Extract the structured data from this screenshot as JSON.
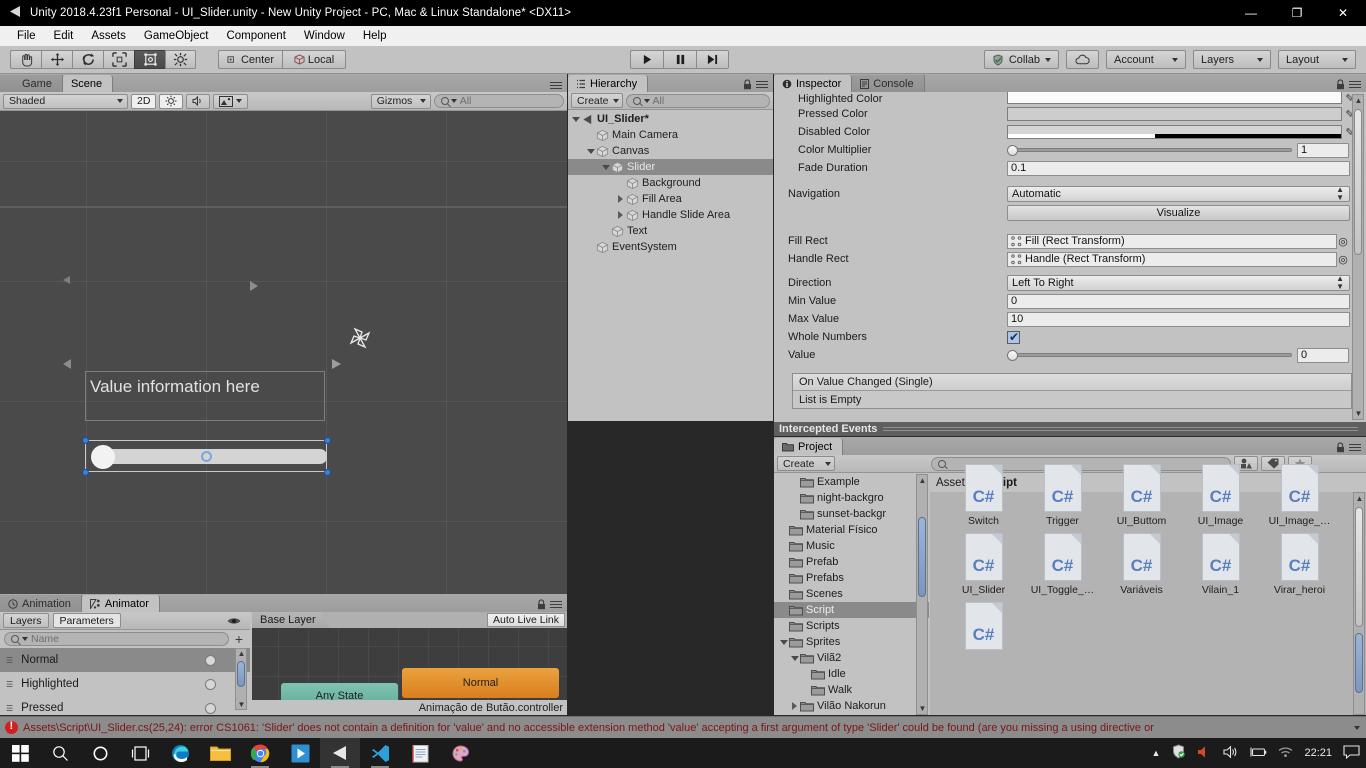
{
  "window": {
    "title": "Unity 2018.4.23f1 Personal - UI_Slider.unity - New Unity Project - PC, Mac & Linux Standalone* <DX11>",
    "minimize": "—",
    "maximize": "❐",
    "close": "✕"
  },
  "menubar": {
    "items": [
      "File",
      "Edit",
      "Assets",
      "GameObject",
      "Component",
      "Window",
      "Help"
    ]
  },
  "toolbar": {
    "transform_tools": [
      "hand-tool",
      "move-tool",
      "rotate-tool",
      "scale-tool",
      "rect-tool",
      "transform-tool"
    ],
    "selected_tool_index": 4,
    "pivot_label": "Center",
    "space_label": "Local",
    "play": "▶",
    "pause": "❙❙",
    "step": "▶❘",
    "collab_label": "Collab",
    "cloud_label": "☁",
    "account_label": "Account",
    "layers_label": "Layers",
    "layout_label": "Layout"
  },
  "scene_view": {
    "tabs": [
      {
        "label": "Game",
        "active": false
      },
      {
        "label": "Scene",
        "active": true
      }
    ],
    "shading_mode": "Shaded",
    "mode_2d": "2D",
    "gizmos_label": "Gizmos",
    "search_placeholder": "All",
    "canvas_text": "Value information here",
    "slider_value_position_pct": 0
  },
  "hierarchy": {
    "title": "Hierarchy",
    "create_label": "Create",
    "search_placeholder": "All",
    "items": [
      {
        "label": "UI_Slider*",
        "depth": 0,
        "foldout": "open",
        "icon": "unity-scene-icon",
        "root": true,
        "selected": false
      },
      {
        "label": "Main Camera",
        "depth": 1,
        "foldout": "none",
        "icon": "gameobject-icon",
        "selected": false
      },
      {
        "label": "Canvas",
        "depth": 1,
        "foldout": "open",
        "icon": "gameobject-icon",
        "selected": false
      },
      {
        "label": "Slider",
        "depth": 2,
        "foldout": "open",
        "icon": "gameobject-icon",
        "selected": true
      },
      {
        "label": "Background",
        "depth": 3,
        "foldout": "none",
        "icon": "gameobject-icon",
        "selected": false
      },
      {
        "label": "Fill Area",
        "depth": 3,
        "foldout": "closed",
        "icon": "gameobject-icon",
        "selected": false
      },
      {
        "label": "Handle Slide Area",
        "depth": 3,
        "foldout": "closed",
        "icon": "gameobject-icon",
        "selected": false
      },
      {
        "label": "Text",
        "depth": 2,
        "foldout": "none",
        "icon": "gameobject-icon",
        "selected": false
      },
      {
        "label": "EventSystem",
        "depth": 1,
        "foldout": "none",
        "icon": "gameobject-icon",
        "selected": false
      }
    ]
  },
  "inspector": {
    "tabs": [
      {
        "label": "Inspector",
        "active": true,
        "icon": "info-icon"
      },
      {
        "label": "Console",
        "active": false,
        "icon": "console-icon"
      }
    ],
    "rows": [
      {
        "kind": "color",
        "label": "Highlighted Color",
        "value": ""
      },
      {
        "kind": "color",
        "label": "Pressed Color",
        "value": ""
      },
      {
        "kind": "color",
        "label": "Disabled Color",
        "value": ""
      },
      {
        "kind": "slider",
        "label": "Color Multiplier",
        "value": "1",
        "knob_pct": 0
      },
      {
        "kind": "text",
        "label": "Fade Duration",
        "value": "0.1"
      }
    ],
    "navigation_label": "Navigation",
    "navigation_value": "Automatic",
    "visualize_label": "Visualize",
    "fill_rect_label": "Fill Rect",
    "fill_rect_value": "Fill (Rect Transform)",
    "handle_rect_label": "Handle Rect",
    "handle_rect_value": "Handle (Rect Transform)",
    "direction_label": "Direction",
    "direction_value": "Left To Right",
    "min_value_label": "Min Value",
    "min_value": "0",
    "max_value_label": "Max Value",
    "max_value": "10",
    "whole_numbers_label": "Whole Numbers",
    "whole_numbers_checked": true,
    "value_label": "Value",
    "value": "0",
    "value_knob_pct": 0,
    "event_header": "On Value Changed (Single)",
    "event_body": "List is Empty"
  },
  "intercepted_events": {
    "label": "Intercepted Events"
  },
  "project": {
    "title": "Project",
    "create_label": "Create",
    "search_placeholder": "",
    "breadcrumb": [
      "Assets",
      "Script"
    ],
    "folders": [
      {
        "label": "Example",
        "depth": 3,
        "foldout": "none",
        "selected": false
      },
      {
        "label": "night-backgro",
        "depth": 3,
        "foldout": "none",
        "selected": false
      },
      {
        "label": "sunset-backgr",
        "depth": 3,
        "foldout": "none",
        "selected": false
      },
      {
        "label": "Material Físico",
        "depth": 2,
        "foldout": "none",
        "selected": false
      },
      {
        "label": "Music",
        "depth": 2,
        "foldout": "none",
        "selected": false
      },
      {
        "label": "Prefab",
        "depth": 2,
        "foldout": "none",
        "selected": false
      },
      {
        "label": "Prefabs",
        "depth": 2,
        "foldout": "none",
        "selected": false
      },
      {
        "label": "Scenes",
        "depth": 2,
        "foldout": "none",
        "selected": false
      },
      {
        "label": "Script",
        "depth": 2,
        "foldout": "none",
        "selected": true
      },
      {
        "label": "Scripts",
        "depth": 2,
        "foldout": "none",
        "selected": false
      },
      {
        "label": "Sprites",
        "depth": 2,
        "foldout": "open",
        "selected": false
      },
      {
        "label": "Vilã2",
        "depth": 3,
        "foldout": "open",
        "selected": false
      },
      {
        "label": "Idle",
        "depth": 4,
        "foldout": "none",
        "selected": false
      },
      {
        "label": "Walk",
        "depth": 4,
        "foldout": "none",
        "selected": false
      },
      {
        "label": "Vilão Nakorun",
        "depth": 3,
        "foldout": "closed",
        "selected": false
      }
    ],
    "assets": [
      {
        "name": "Switch",
        "icon": "csharp-script-icon"
      },
      {
        "name": "Trigger",
        "icon": "csharp-script-icon"
      },
      {
        "name": "UI_Buttom",
        "icon": "csharp-script-icon"
      },
      {
        "name": "UI_Image",
        "icon": "csharp-script-icon"
      },
      {
        "name": "UI_Image_…",
        "icon": "csharp-script-icon"
      },
      {
        "name": "UI_Slider",
        "icon": "csharp-script-icon"
      },
      {
        "name": "UI_Toggle_…",
        "icon": "csharp-script-icon"
      },
      {
        "name": "Variáveis",
        "icon": "csharp-script-icon"
      },
      {
        "name": "Vilain_1",
        "icon": "csharp-script-icon"
      },
      {
        "name": "Virar_heroi",
        "icon": "csharp-script-icon"
      },
      {
        "name": "",
        "icon": "csharp-script-icon"
      }
    ],
    "icon_label": "C#"
  },
  "animator": {
    "tabs": [
      {
        "label": "Animation",
        "active": false,
        "icon": "clock-icon"
      },
      {
        "label": "Animator",
        "active": true,
        "icon": "animator-icon"
      }
    ],
    "layers_tab": "Layers",
    "parameters_tab": "Parameters",
    "search_placeholder": "Name",
    "add_label": "+",
    "parameters": [
      {
        "label": "Normal",
        "selected": true
      },
      {
        "label": "Highlighted",
        "selected": false
      },
      {
        "label": "Pressed",
        "selected": false
      }
    ],
    "base_layer_label": "Base Layer",
    "auto_live_link": "Auto Live Link",
    "states": [
      {
        "label": "Any State",
        "color": "#74b7a8"
      },
      {
        "label": "Normal",
        "color": "#e0922f"
      }
    ],
    "controller_name": "Animação de Butão.controller"
  },
  "status_bar": {
    "message": "Assets\\Script\\UI_Slider.cs(25,24): error CS1061: 'Slider' does not contain a definition for 'value' and no accessible extension method 'value' accepting a first argument of type 'Slider' could be found (are you missing a using directive or"
  },
  "taskbar": {
    "items": [
      {
        "name": "start-button",
        "glyph": "⊞",
        "color": "#ffffff",
        "active": false,
        "running": false
      },
      {
        "name": "search-icon",
        "glyph": "⚲",
        "color": "#ffffff",
        "active": false,
        "running": false
      },
      {
        "name": "cortana-icon",
        "glyph": "○",
        "color": "#ffffff",
        "active": false,
        "running": false
      },
      {
        "name": "task-view-icon",
        "glyph": "▣",
        "color": "#ffffff",
        "active": false,
        "running": false
      },
      {
        "name": "edge-icon",
        "glyph": "◔",
        "color": "#2d8ccd",
        "active": false,
        "running": false
      },
      {
        "name": "file-explorer-icon",
        "glyph": "▃",
        "color": "#f5c046",
        "active": false,
        "running": false
      },
      {
        "name": "chrome-icon",
        "glyph": "◉",
        "color": "#dd5044",
        "active": false,
        "running": true
      },
      {
        "name": "media-player-icon",
        "glyph": "▶",
        "color": "#3a9ad9",
        "active": false,
        "running": false
      },
      {
        "name": "unity-icon",
        "glyph": "◀",
        "color": "#e4e4e4",
        "active": true,
        "running": true
      },
      {
        "name": "vscode-icon",
        "glyph": "✖",
        "color": "#3c99d4",
        "active": false,
        "running": true
      },
      {
        "name": "notepad-icon",
        "glyph": "▤",
        "color": "#e8e8e8",
        "active": false,
        "running": false
      },
      {
        "name": "paint-icon",
        "glyph": "✿",
        "color": "#d78ab0",
        "active": false,
        "running": false
      }
    ],
    "tray": [
      {
        "name": "hidden-icons-icon",
        "glyph": "▲"
      },
      {
        "name": "security-icon",
        "glyph": "⛨"
      },
      {
        "name": "volume-muted-icon",
        "glyph": "🔈"
      },
      {
        "name": "volume-icon",
        "glyph": "🔊"
      },
      {
        "name": "battery-icon",
        "glyph": "▭"
      },
      {
        "name": "wifi-icon",
        "glyph": "◠"
      }
    ],
    "clock": "22:21",
    "action_center": "▭"
  }
}
